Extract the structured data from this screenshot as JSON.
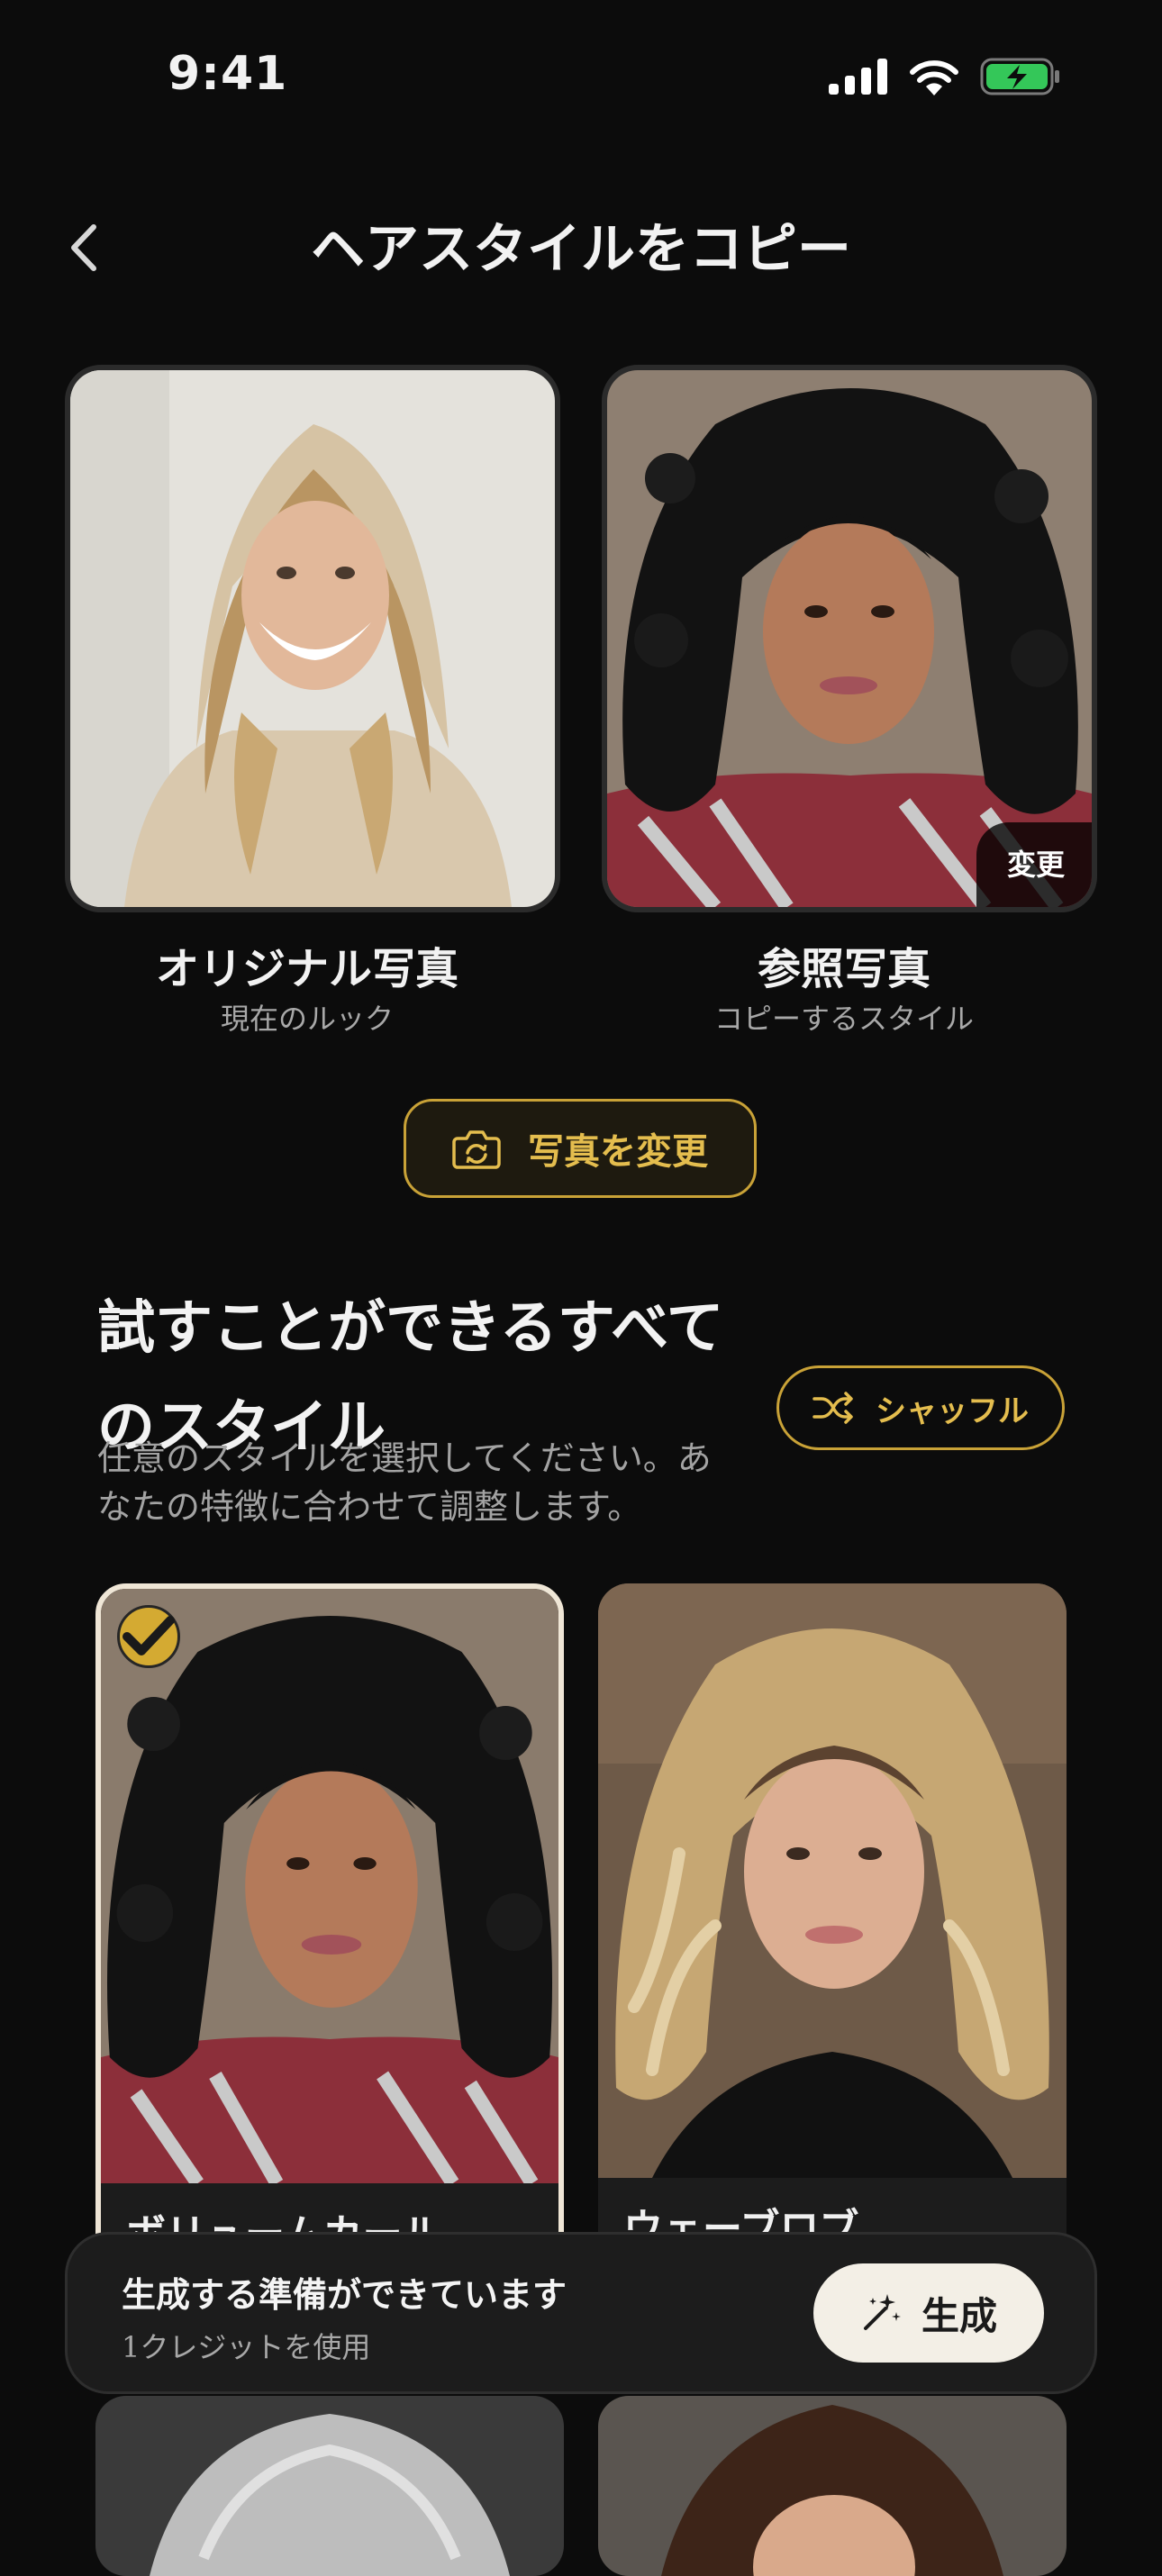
{
  "status_bar": {
    "time": "9:41"
  },
  "header": {
    "title": "ヘアスタイルをコピー"
  },
  "photos": {
    "original": {
      "title": "オリジナル写真",
      "subtitle": "現在のルック"
    },
    "reference": {
      "title": "参照写真",
      "subtitle": "コピーするスタイル",
      "change_chip": "変更"
    }
  },
  "change_photo_button": {
    "label": "写真を変更"
  },
  "styles_section": {
    "title_line1": "試すことができるすべて",
    "title_line2": "のスタイル",
    "description_line1": "任意のスタイルを選択してください。あ",
    "description_line2": "なたの特徴に合わせて調整します。",
    "shuffle_label": "シャッフル",
    "items": [
      {
        "label": "ボリュームカール",
        "selected": true
      },
      {
        "label": "ウェーブロブ",
        "selected": false
      }
    ]
  },
  "generate_bar": {
    "title": "生成する準備ができています",
    "subtitle": "1クレジットを使用",
    "button_label": "生成"
  },
  "colors": {
    "accent": "#d4aa32",
    "background": "#0c0c0c",
    "card": "#1c1c1c",
    "battery": "#34c759"
  },
  "icons": [
    "chevron-left-icon",
    "camera-rotate-icon",
    "shuffle-icon",
    "checkmark-icon",
    "magic-wand-icon",
    "signal-icon",
    "wifi-icon",
    "battery-icon"
  ]
}
